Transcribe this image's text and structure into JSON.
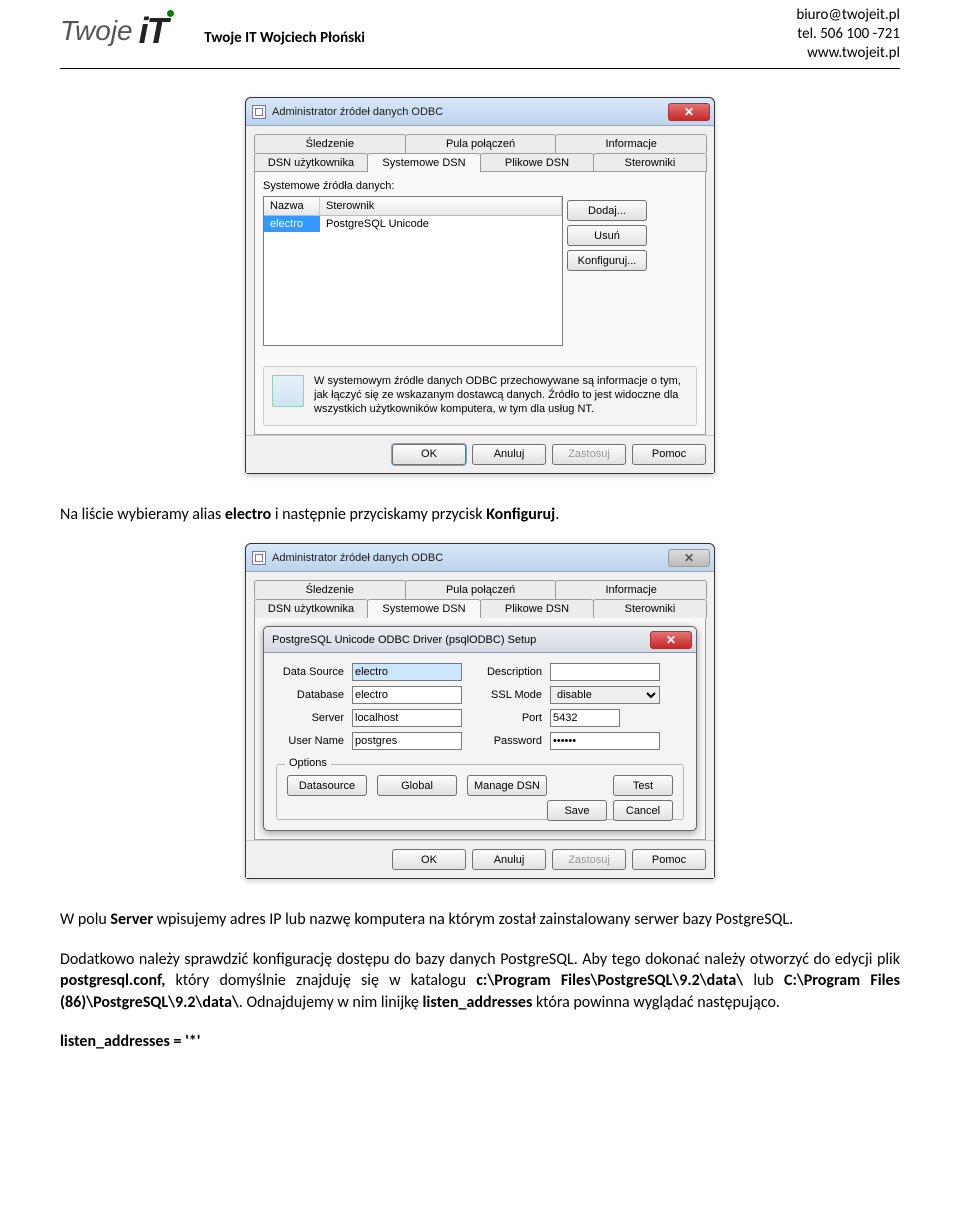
{
  "header": {
    "logo_word1": "Twoje",
    "logo_word2": "iT",
    "company": "Twoje IT Wojciech Płoński",
    "contact_email": "biuro@twojeit.pl",
    "contact_tel": "tel. 506 100 -721",
    "contact_web": "www.twojeit.pl"
  },
  "odbc_admin": {
    "title": "Administrator źródeł danych ODBC",
    "tabs_row1": [
      "Śledzenie",
      "Pula połączeń",
      "Informacje"
    ],
    "tabs_row2": [
      "DSN użytkownika",
      "Systemowe DSN",
      "Plikowe DSN",
      "Sterowniki"
    ],
    "active_tab": "Systemowe DSN",
    "list_label": "Systemowe źródła danych:",
    "col_name": "Nazwa",
    "col_driver": "Sterownik",
    "entry_name": "electro",
    "entry_driver": "PostgreSQL Unicode",
    "btn_add": "Dodaj...",
    "btn_remove": "Usuń",
    "btn_config": "Konfiguruj...",
    "info_text": "W systemowym źródle danych ODBC przechowywane są informacje o tym, jak łączyć się ze wskazanym dostawcą danych. Źródło to jest widoczne dla wszystkich użytkowników komputera, w tym dla usług NT.",
    "btn_ok": "OK",
    "btn_cancel": "Anuluj",
    "btn_apply": "Zastosuj",
    "btn_help": "Pomoc"
  },
  "odbc_setup": {
    "title": "PostgreSQL Unicode ODBC Driver (psqlODBC) Setup",
    "lbl_datasource": "Data Source",
    "lbl_database": "Database",
    "lbl_server": "Server",
    "lbl_username": "User Name",
    "lbl_description": "Description",
    "lbl_sslmode": "SSL Mode",
    "lbl_port": "Port",
    "lbl_password": "Password",
    "val_datasource": "electro",
    "val_database": "electro",
    "val_server": "localhost",
    "val_username": "postgres",
    "val_description": "",
    "val_sslmode": "disable",
    "val_port": "5432",
    "val_password": "••••••",
    "options_label": "Options",
    "btn_datasource": "Datasource",
    "btn_global": "Global",
    "btn_managedsn": "Manage DSN",
    "btn_test": "Test",
    "btn_save": "Save",
    "btn_cancel": "Cancel"
  },
  "para1_pre": "Na liście wybieramy alias ",
  "para1_b1": "electro",
  "para1_mid": " i następnie przyciskamy przycisk ",
  "para1_b2": "Konfiguruj",
  "para1_end": ".",
  "para2_pre": "W polu ",
  "para2_b1": "Server",
  "para2_end": " wpisujemy adres IP lub nazwę komputera na którym został zainstalowany serwer bazy PostgreSQL.",
  "para3_a": "Dodatkowo należy sprawdzić konfigurację dostępu do bazy danych PostgreSQL. Aby tego dokonać należy otworzyć do edycji plik ",
  "para3_b1": "postgresql.conf,",
  "para3_b": " który domyślnie znajduję się w katalogu ",
  "para3_b2": "c:\\Program Files\\PostgreSQL\\9.2\\data\\",
  "para3_c": " lub ",
  "para3_b3": "C:\\Program Files (86)\\PostgreSQL\\9.2\\data\\",
  "para3_d": ". Odnajdujemy w nim linijkę ",
  "para3_b4": "listen_addresses",
  "para3_e": " która powinna wyglądać następująco.",
  "para4": "listen_addresses = '*'"
}
